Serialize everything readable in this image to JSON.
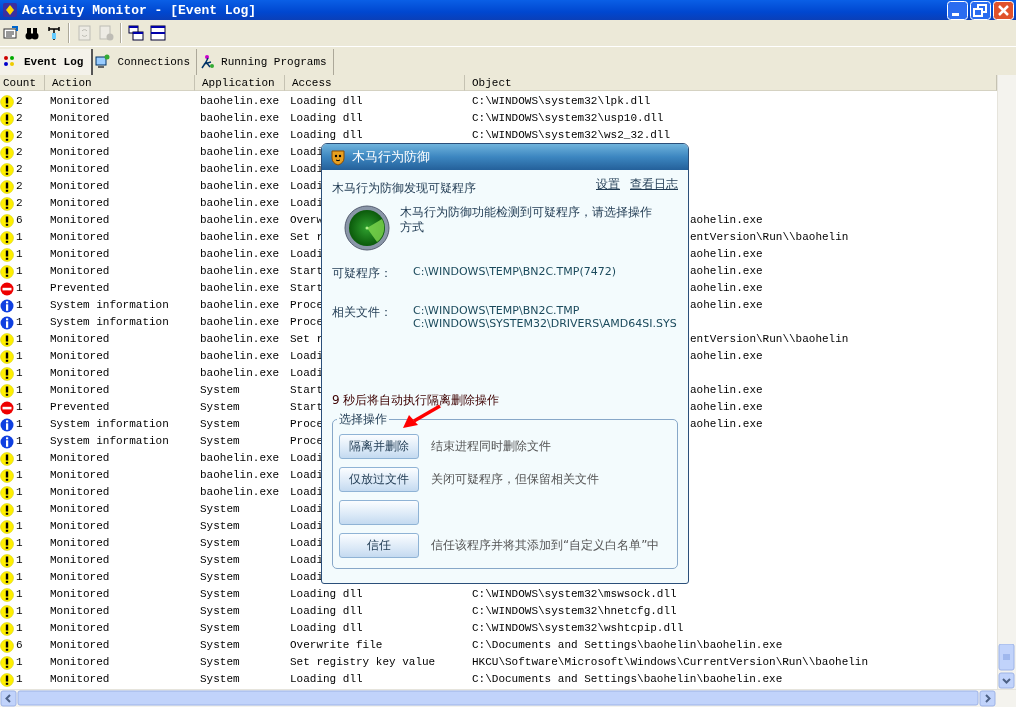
{
  "window": {
    "title": "Activity Monitor - [Event Log]"
  },
  "toolbar": [
    {
      "kind": "properties",
      "disabled": false
    },
    {
      "kind": "binoculars",
      "disabled": false
    },
    {
      "kind": "antenna",
      "disabled": false
    },
    {
      "kind": "refresh",
      "disabled": true
    },
    {
      "kind": "document",
      "disabled": true
    },
    {
      "kind": "cascade",
      "disabled": false
    },
    {
      "kind": "tile",
      "disabled": false
    }
  ],
  "tabs": [
    {
      "label": "Event Log",
      "selected": true
    },
    {
      "label": "Connections",
      "selected": false
    },
    {
      "label": "Running Programs",
      "selected": false
    }
  ],
  "table": {
    "columns": [
      "Count",
      "Action",
      "Application",
      "Access",
      "Object"
    ],
    "rows": [
      {
        "kind": "warning",
        "count": "2",
        "action": "Monitored",
        "application": "baohelin.exe",
        "access": "Loading dll",
        "object": "C:\\WINDOWS\\system32\\lpk.dll"
      },
      {
        "kind": "warning",
        "count": "2",
        "action": "Monitored",
        "application": "baohelin.exe",
        "access": "Loading dll",
        "object": "C:\\WINDOWS\\system32\\usp10.dll"
      },
      {
        "kind": "warning",
        "count": "2",
        "action": "Monitored",
        "application": "baohelin.exe",
        "access": "Loading dll",
        "object": "C:\\WINDOWS\\system32\\ws2_32.dll"
      },
      {
        "kind": "warning",
        "count": "2",
        "action": "Monitored",
        "application": "baohelin.exe",
        "access": "Loadi"
      },
      {
        "kind": "warning",
        "count": "2",
        "action": "Monitored",
        "application": "baohelin.exe",
        "access": "Loadi"
      },
      {
        "kind": "warning",
        "count": "2",
        "action": "Monitored",
        "application": "baohelin.exe",
        "access": "Loadi"
      },
      {
        "kind": "warning",
        "count": "2",
        "action": "Monitored",
        "application": "baohelin.exe",
        "access": "Loadi"
      },
      {
        "kind": "warning",
        "count": "6",
        "action": "Monitored",
        "application": "baohelin.exe",
        "access": "Overw",
        "object": "aohelin.exe"
      },
      {
        "kind": "warning",
        "count": "1",
        "action": "Monitored",
        "application": "baohelin.exe",
        "access": "Set r",
        "object": "entVersion\\Run\\\\baohelin"
      },
      {
        "kind": "warning",
        "count": "1",
        "action": "Monitored",
        "application": "baohelin.exe",
        "access": "Loadi",
        "object": "aohelin.exe"
      },
      {
        "kind": "warning",
        "count": "1",
        "action": "Monitored",
        "application": "baohelin.exe",
        "access": "Start",
        "object": "aohelin.exe"
      },
      {
        "kind": "prevented",
        "count": "1",
        "action": "Prevented",
        "application": "baohelin.exe",
        "access": "Start",
        "object": "aohelin.exe"
      },
      {
        "kind": "info",
        "count": "1",
        "action": "System information",
        "application": "baohelin.exe",
        "access": "Proce",
        "object": "aohelin.exe"
      },
      {
        "kind": "info",
        "count": "1",
        "action": "System information",
        "application": "baohelin.exe",
        "access": "Proce"
      },
      {
        "kind": "warning",
        "count": "1",
        "action": "Monitored",
        "application": "baohelin.exe",
        "access": "Set r",
        "object": "entVersion\\Run\\\\baohelin"
      },
      {
        "kind": "warning",
        "count": "1",
        "action": "Monitored",
        "application": "baohelin.exe",
        "access": "Loadi",
        "object": "aohelin.exe"
      },
      {
        "kind": "warning",
        "count": "1",
        "action": "Monitored",
        "application": "baohelin.exe",
        "access": "Loadi"
      },
      {
        "kind": "warning",
        "count": "1",
        "action": "Monitored",
        "application": "System",
        "access": "Start",
        "object": "aohelin.exe"
      },
      {
        "kind": "prevented",
        "count": "1",
        "action": "Prevented",
        "application": "System",
        "access": "Start",
        "object": "aohelin.exe"
      },
      {
        "kind": "info",
        "count": "1",
        "action": "System information",
        "application": "System",
        "access": "Proce",
        "object": "aohelin.exe"
      },
      {
        "kind": "info",
        "count": "1",
        "action": "System information",
        "application": "System",
        "access": "Proce"
      },
      {
        "kind": "warning",
        "count": "1",
        "action": "Monitored",
        "application": "baohelin.exe",
        "access": "Loadi"
      },
      {
        "kind": "warning",
        "count": "1",
        "action": "Monitored",
        "application": "baohelin.exe",
        "access": "Loadi"
      },
      {
        "kind": "warning",
        "count": "1",
        "action": "Monitored",
        "application": "baohelin.exe",
        "access": "Loadi"
      },
      {
        "kind": "warning",
        "count": "1",
        "action": "Monitored",
        "application": "System",
        "access": "Loadi"
      },
      {
        "kind": "warning",
        "count": "1",
        "action": "Monitored",
        "application": "System",
        "access": "Loadi"
      },
      {
        "kind": "warning",
        "count": "1",
        "action": "Monitored",
        "application": "System",
        "access": "Loadi"
      },
      {
        "kind": "warning",
        "count": "1",
        "action": "Monitored",
        "application": "System",
        "access": "Loadi"
      },
      {
        "kind": "warning",
        "count": "1",
        "action": "Monitored",
        "application": "System",
        "access": "Loadi"
      },
      {
        "kind": "warning",
        "count": "1",
        "action": "Monitored",
        "application": "System",
        "access": "Loading dll",
        "object": "C:\\WINDOWS\\system32\\mswsock.dll"
      },
      {
        "kind": "warning",
        "count": "1",
        "action": "Monitored",
        "application": "System",
        "access": "Loading dll",
        "object": "C:\\WINDOWS\\system32\\hnetcfg.dll"
      },
      {
        "kind": "warning",
        "count": "1",
        "action": "Monitored",
        "application": "System",
        "access": "Loading dll",
        "object": "C:\\WINDOWS\\system32\\wshtcpip.dll"
      },
      {
        "kind": "warning",
        "count": "6",
        "action": "Monitored",
        "application": "System",
        "access": "Overwrite file",
        "object": "C:\\Documents and Settings\\baohelin\\baohelin.exe"
      },
      {
        "kind": "warning",
        "count": "1",
        "action": "Monitored",
        "application": "System",
        "access": "Set registry key value",
        "object": "HKCU\\Software\\Microsoft\\Windows\\CurrentVersion\\Run\\\\baohelin"
      },
      {
        "kind": "warning",
        "count": "1",
        "action": "Monitored",
        "application": "System",
        "access": "Loading dll",
        "object": "C:\\Documents and Settings\\baohelin\\baohelin.exe"
      }
    ]
  },
  "dialog": {
    "title": "木马行为防御",
    "heading": "木马行为防御发现可疑程序",
    "links": [
      "设置",
      "查看日志"
    ],
    "message": "木马行为防御功能检测到可疑程序，请选择操作方式",
    "fields": [
      {
        "label": "可疑程序：",
        "values": [
          "C:\\WINDOWS\\TEMP\\BN2C.TMP(7472)"
        ]
      },
      {
        "label": "相关文件：",
        "values": [
          "C:\\WINDOWS\\TEMP\\BN2C.TMP",
          "C:\\WINDOWS\\SYSTEM32\\DRIVERS\\AMD64SI.SYS"
        ]
      }
    ],
    "countdown": "9 秒后将自动执行隔离删除操作",
    "group_title": "选择操作",
    "options": [
      {
        "kind": "action",
        "label": "隔离并删除",
        "description": "结束进程同时删除文件"
      },
      {
        "kind": "action",
        "label": "仅放过文件",
        "description": "关闭可疑程序，但保留相关文件"
      },
      {
        "kind": "blank"
      },
      {
        "kind": "action",
        "label": "信任",
        "description": "信任该程序并将其添加到“自定义白名单”中"
      }
    ]
  }
}
